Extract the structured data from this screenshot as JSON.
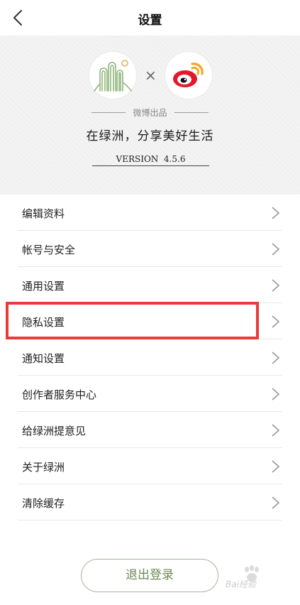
{
  "nav": {
    "title": "设置",
    "back_icon": "chevron-left-icon"
  },
  "hero": {
    "oasis_logo": "oasis-logo",
    "times_symbol": "×",
    "weibo_logo": "weibo-logo",
    "produced_by": "微博出品",
    "slogan": "在绿洲，分享美好生活",
    "version": "VERSION  4.5.6"
  },
  "menu": {
    "items": [
      {
        "label": "编辑资料"
      },
      {
        "label": "帐号与安全"
      },
      {
        "label": "通用设置"
      },
      {
        "label": "隐私设置"
      },
      {
        "label": "通知设置"
      },
      {
        "label": "创作者服务中心"
      },
      {
        "label": "给绿洲提意见"
      },
      {
        "label": "关于绿洲"
      },
      {
        "label": "清除缓存"
      }
    ]
  },
  "logout": {
    "label": "退出登录"
  },
  "watermark": {
    "text": "Bai经验",
    "icon": "baidu-paw-icon"
  },
  "colors": {
    "accent": "#6c8a55",
    "highlight": "#ea3a3a",
    "hero_bg": "#f3f3f3",
    "weibo_red": "#e6162d",
    "weibo_orange": "#f5a623"
  }
}
